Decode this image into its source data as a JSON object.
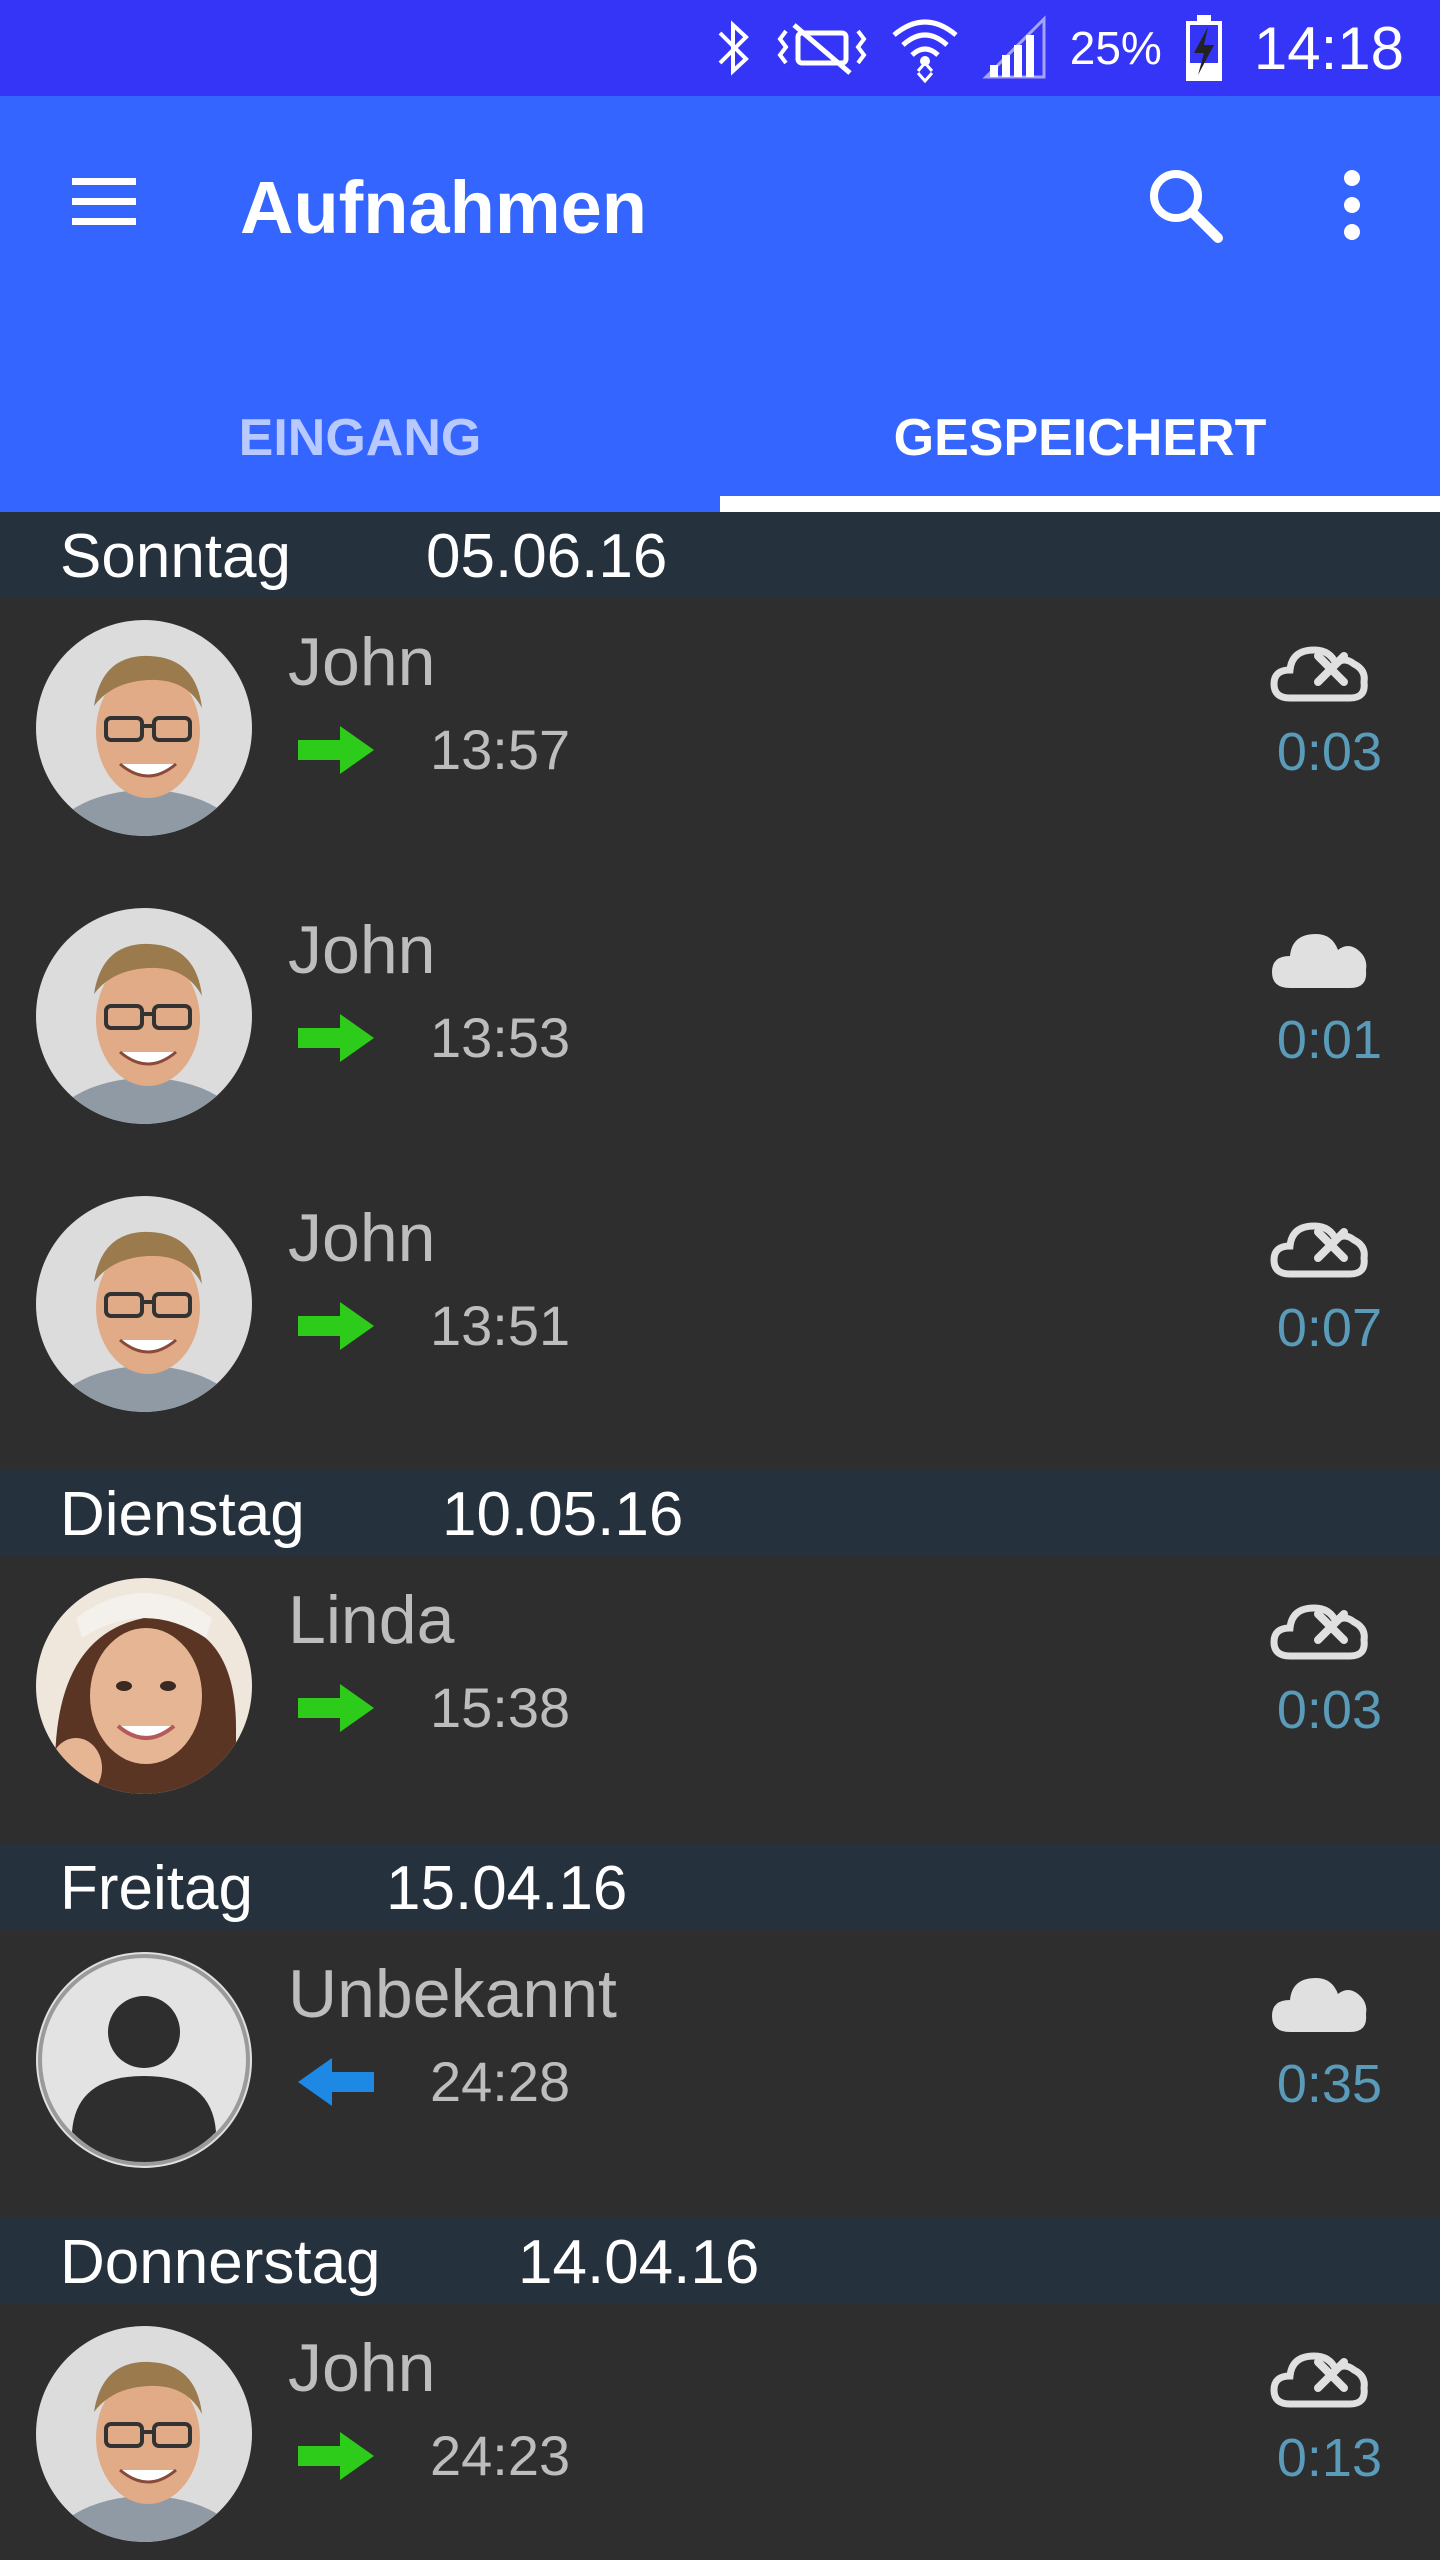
{
  "status_bar": {
    "battery": "25%",
    "time": "14:18",
    "icons": [
      "bluetooth-icon",
      "vibrate-icon",
      "wifi-icon",
      "signal-icon",
      "battery-charging-icon"
    ]
  },
  "app_bar": {
    "title": "Aufnahmen",
    "icons": [
      "menu-icon",
      "search-icon",
      "more-vert-icon"
    ]
  },
  "tabs": [
    {
      "label": "EINGANG",
      "selected": false
    },
    {
      "label": "GESPEICHERT",
      "selected": true
    }
  ],
  "groups": [
    {
      "day": "Sonntag",
      "date": "05.06.16",
      "items": [
        {
          "name": "John",
          "direction": "outgoing",
          "time": "13:57",
          "cloud": "cloud-off-icon",
          "duration": "0:03"
        },
        {
          "name": "John",
          "direction": "outgoing",
          "time": "13:53",
          "cloud": "cloud-icon",
          "duration": "0:01"
        },
        {
          "name": "John",
          "direction": "outgoing",
          "time": "13:51",
          "cloud": "cloud-off-icon",
          "duration": "0:07"
        }
      ]
    },
    {
      "day": "Dienstag",
      "date": "10.05.16",
      "items": [
        {
          "name": "Linda",
          "direction": "outgoing",
          "time": "15:38",
          "cloud": "cloud-off-icon",
          "duration": "0:03"
        }
      ]
    },
    {
      "day": "Freitag",
      "date": "15.04.16",
      "items": [
        {
          "name": "Unbekannt",
          "direction": "incoming",
          "time": "24:28",
          "cloud": "cloud-icon",
          "duration": "0:35"
        }
      ]
    },
    {
      "day": "Donnerstag",
      "date": "14.04.16",
      "items": [
        {
          "name": "John",
          "direction": "outgoing",
          "time": "24:23",
          "cloud": "cloud-off-icon",
          "duration": "0:13"
        }
      ]
    }
  ],
  "colors": {
    "status_bar": "#3535f7",
    "app_bar": "#3465fe",
    "list_bg": "#2e2e2e",
    "header_bg": "#25313d",
    "outgoing_arrow": "#2ecc1a",
    "incoming_arrow": "#1e88e5",
    "duration_text": "#5a9bb9"
  }
}
